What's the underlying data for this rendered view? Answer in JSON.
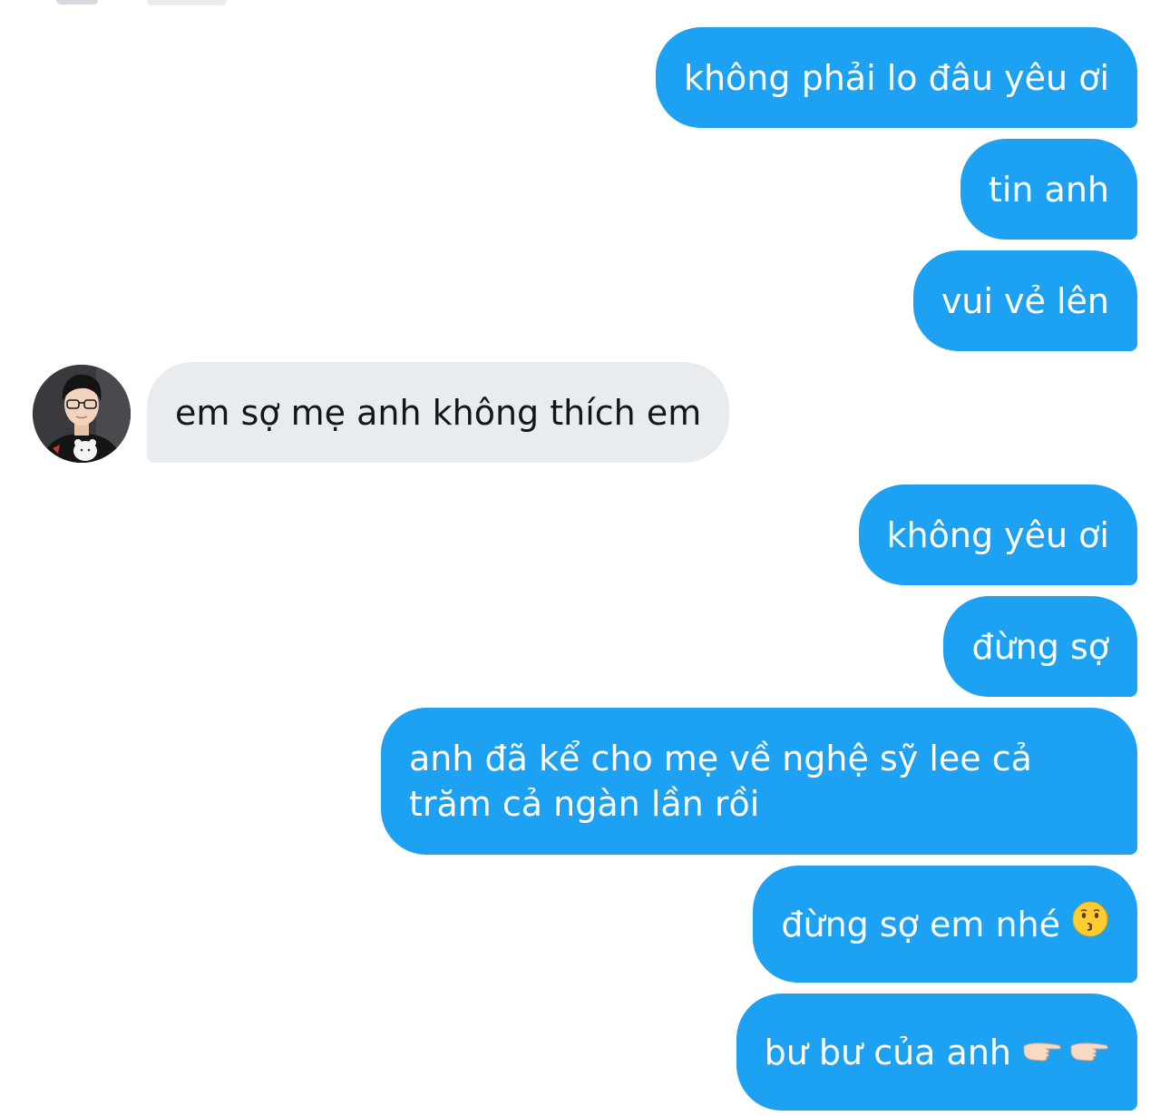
{
  "messages": [
    {
      "direction": "outgoing",
      "text": "không phải lo đâu yêu ơi"
    },
    {
      "direction": "outgoing",
      "text": "tin anh"
    },
    {
      "direction": "outgoing",
      "text": "vui vẻ lên"
    },
    {
      "direction": "incoming",
      "text": "em sợ mẹ anh không thích em"
    },
    {
      "direction": "outgoing",
      "text": "không yêu ơi"
    },
    {
      "direction": "outgoing",
      "text": "đừng sợ"
    },
    {
      "direction": "outgoing",
      "text": "anh đã kể cho mẹ về nghệ sỹ lee cả trăm cả ngàn lần rồi"
    },
    {
      "direction": "outgoing",
      "text": "đừng sợ em nhé",
      "emoji": [
        "kissing-face"
      ]
    },
    {
      "direction": "outgoing",
      "text": "bư bư của anh",
      "emoji": [
        "pointing-hand",
        "pointing-hand"
      ]
    }
  ],
  "colors": {
    "outgoing_bubble": "#1da1f2",
    "incoming_bubble": "#e8ecef",
    "outgoing_text": "#ffffff",
    "incoming_text": "#14171a"
  }
}
